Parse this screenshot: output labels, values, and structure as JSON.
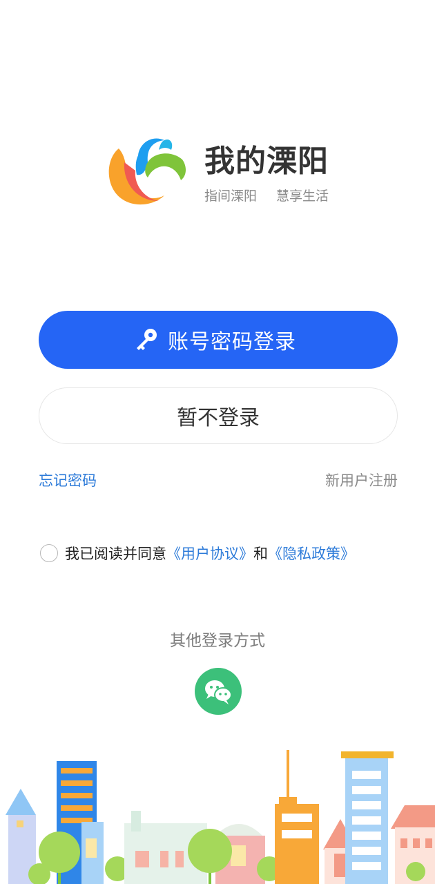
{
  "app": {
    "title": "我的溧阳",
    "slogan_1": "指间溧阳",
    "slogan_2": "慧享生活"
  },
  "login": {
    "primary_label": "账号密码登录",
    "skip_label": "暂不登录",
    "forgot_label": "忘记密码",
    "register_label": "新用户注册"
  },
  "agreement": {
    "prefix": "我已阅读并同意",
    "user_agreement": "《用户协议》",
    "and": "和",
    "privacy_policy": "《隐私政策》"
  },
  "other_login": {
    "title": "其他登录方式",
    "wechat_icon": "wechat-icon"
  },
  "colors": {
    "primary": "#2565f5",
    "link": "#2d7bd9",
    "wechat": "#3cc07a"
  }
}
